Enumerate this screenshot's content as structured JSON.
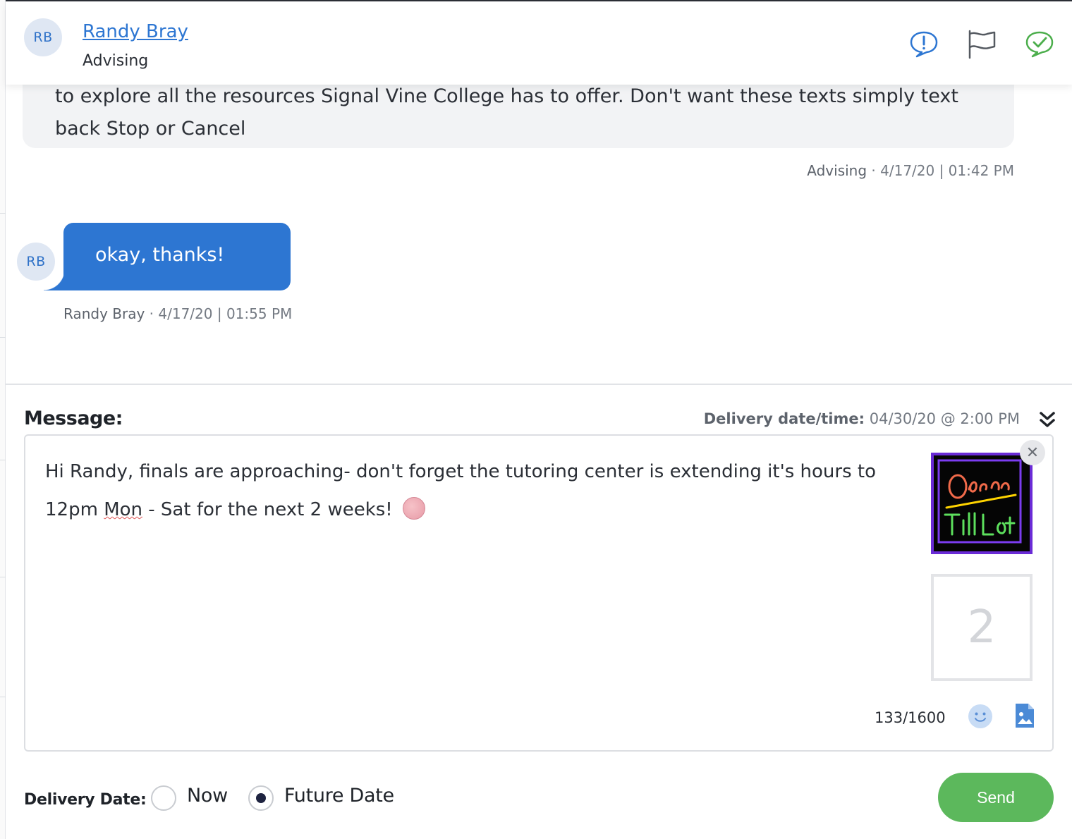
{
  "header": {
    "initials": "RB",
    "contact_name": "Randy Bray",
    "department": "Advising",
    "icons": {
      "alert": "alert-bubble-icon",
      "flag": "flag-icon",
      "resolve": "check-bubble-icon"
    },
    "colors": {
      "alert": "#2d76d2",
      "flag": "#555a61",
      "resolve": "#4cae4c"
    }
  },
  "conversation": {
    "outgoing": {
      "text": "to explore all the resources Signal Vine College has to offer. Don't want these texts simply text back Stop or Cancel",
      "sender": "Advising",
      "timestamp": "4/17/20 | 01:42 PM"
    },
    "incoming": {
      "initials": "RB",
      "text": "okay, thanks!",
      "sender": "Randy Bray",
      "timestamp": "4/17/20 | 01:55 PM"
    }
  },
  "composer": {
    "label": "Message:",
    "delivery_label": "Delivery date/time:",
    "delivery_value": "04/30/20 @ 2:00 PM",
    "text_part1": "Hi Randy, finals are approaching- don't forget the tutoring center is extending it's hours to 12pm ",
    "text_misspelled": "Mon",
    "text_part2": " - Sat for the next 2 weeks!",
    "attachment_placeholder": "2",
    "remove_symbol": "✕",
    "char_count": "133/1600"
  },
  "footer": {
    "delivery_date_label": "Delivery Date:",
    "options": [
      {
        "label": "Now",
        "selected": false
      },
      {
        "label": "Future Date",
        "selected": true
      }
    ],
    "send_label": "Send"
  },
  "colors": {
    "accent": "#2d76d2",
    "send": "#5cb85c",
    "bubble_out": "#f2f3f5"
  }
}
